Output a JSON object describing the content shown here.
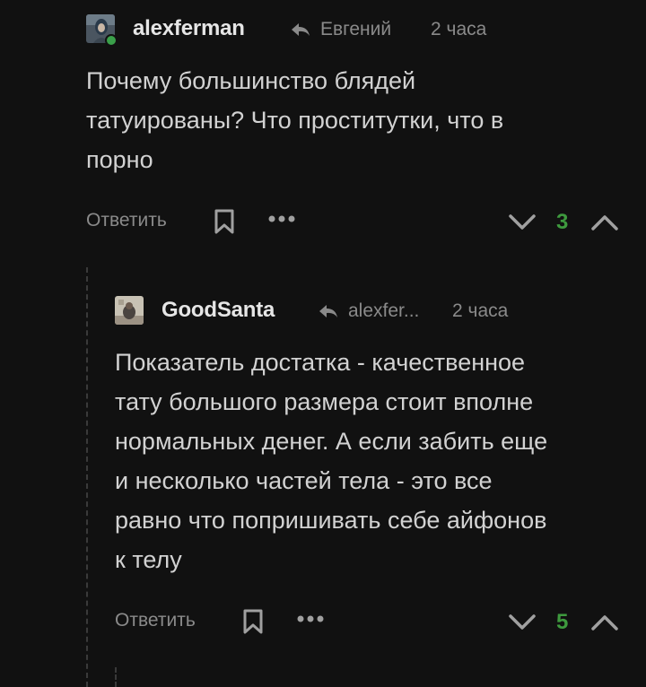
{
  "comments": [
    {
      "author": "alexferman",
      "reply_to": "Евгений",
      "time": "2 часа",
      "text_lines": [
        "Почему большинство блядей",
        "татуированы? Что проститутки, что в",
        "порно"
      ],
      "reply_label": "Ответить",
      "rating": "3",
      "avatar_icon": "user-avatar-icon",
      "online": true,
      "rating_color": "#3e9a3e"
    },
    {
      "author": "GoodSanta",
      "reply_to": "alexfer...",
      "time": "2 часа",
      "text_lines": [
        "Показатель достатка - качественное",
        "тату большого размера стоит вполне",
        "нормальных денег. А если забить еще",
        "и несколько частей тела - это все",
        "равно что попришивать себе айфонов",
        "к телу"
      ],
      "reply_label": "Ответить",
      "rating": "5",
      "avatar_icon": "user-avatar-icon",
      "online": false,
      "rating_color": "#3e9a3e"
    }
  ],
  "icons": {
    "reply_arrow": "reply-arrow-icon",
    "save": "bookmark-icon",
    "more": "more-dots-icon",
    "downvote": "chevron-down-icon",
    "upvote": "chevron-up-icon"
  },
  "colors": {
    "background": "#111111",
    "text": "#d2d2d2",
    "muted": "#8a8a8a",
    "positive": "#3e9a3e"
  }
}
